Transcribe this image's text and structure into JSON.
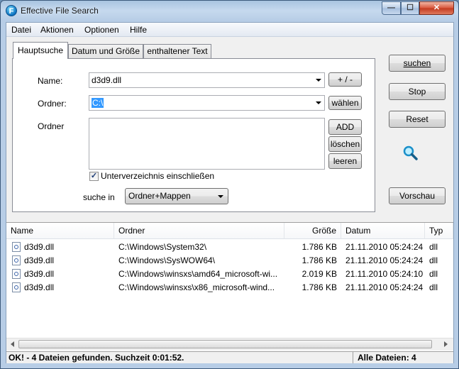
{
  "window": {
    "title": "Effective File Search",
    "icon": "app-logo-icon",
    "min_glyph": "—",
    "max_glyph": "☐",
    "close_glyph": "✕"
  },
  "menu": [
    "Datei",
    "Aktionen",
    "Optionen",
    "Hilfe"
  ],
  "tabs": [
    "Hauptsuche",
    "Datum und Größe",
    "enthaltener Text"
  ],
  "form": {
    "name_label": "Name:",
    "name_value": "d3d9.dll",
    "plusminus_label": "+ / -",
    "folder_label": "Ordner:",
    "folder_value": "C:\\",
    "choose_label": "wählen",
    "folders_label": "Ordner",
    "add_label": "ADD",
    "delete_label": "löschen",
    "clear_label": "leeren",
    "subdirs_label": "Unterverzeichnis einschließen",
    "subdirs_checked": "✓",
    "search_in_label": "suche in",
    "search_in_value": "Ordner+Mappen"
  },
  "buttons": {
    "search": "suchen",
    "stop": "Stop",
    "reset": "Reset",
    "preview": "Vorschau"
  },
  "columns": [
    "Name",
    "Ordner",
    "Größe",
    "Datum",
    "Typ"
  ],
  "rows": [
    {
      "name": "d3d9.dll",
      "folder": "C:\\Windows\\System32\\",
      "size": "1.786 KB",
      "date": "21.11.2010 05:24:24",
      "type": "dll"
    },
    {
      "name": "d3d9.dll",
      "folder": "C:\\Windows\\SysWOW64\\",
      "size": "1.786 KB",
      "date": "21.11.2010 05:24:24",
      "type": "dll"
    },
    {
      "name": "d3d9.dll",
      "folder": "C:\\Windows\\winsxs\\amd64_microsoft-wi...",
      "size": "2.019 KB",
      "date": "21.11.2010 05:24:10",
      "type": "dll"
    },
    {
      "name": "d3d9.dll",
      "folder": "C:\\Windows\\winsxs\\x86_microsoft-wind...",
      "size": "1.786 KB",
      "date": "21.11.2010 05:24:24",
      "type": "dll"
    }
  ],
  "status": {
    "left": "OK! - 4 Dateien gefunden. Suchzeit 0:01:52.",
    "right": "Alle Dateien: 4"
  }
}
